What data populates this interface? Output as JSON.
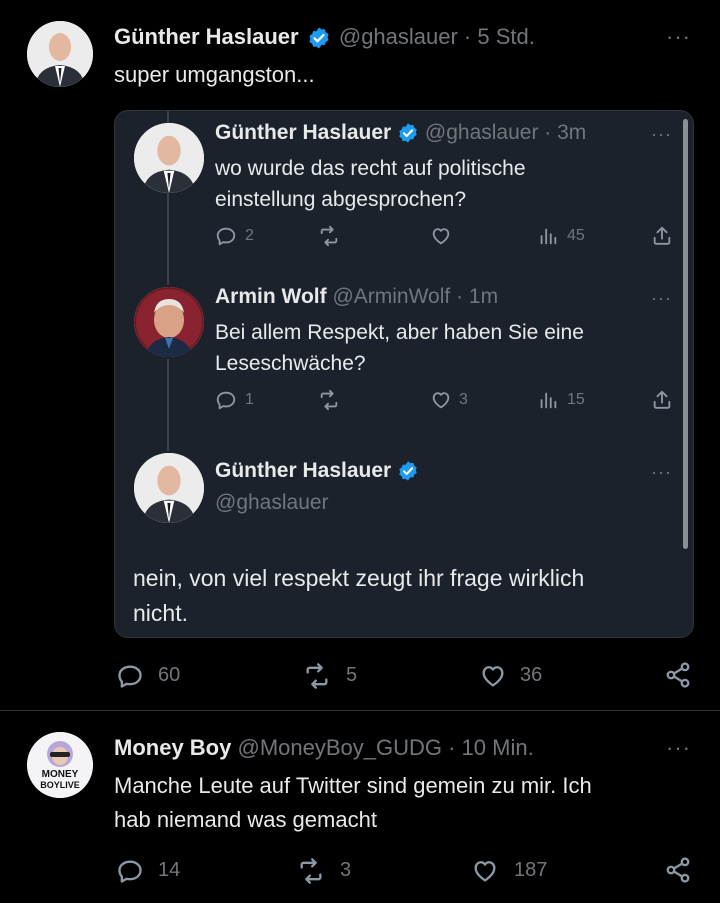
{
  "tweet1": {
    "author_name": "Günther Haslauer",
    "author_handle_time": "@ghaslauer · 5 Std.",
    "text": "super umgangston...",
    "quote": {
      "reply1": {
        "author_name": "Günther Haslauer",
        "author_handle_time": "@ghaslauer · 3m",
        "text_line1": "wo wurde das recht auf politische",
        "text_line2": "einstellung abgesprochen?",
        "replies": "2",
        "views": "45"
      },
      "reply2": {
        "author_name": "Armin Wolf",
        "author_handle_time": "@ArminWolf · 1m",
        "text_line1": "Bei allem Respekt, aber haben Sie eine",
        "text_line2": "Leseschwäche?",
        "replies": "1",
        "likes": "3",
        "views": "15"
      },
      "reply3": {
        "author_name": "Günther Haslauer",
        "author_handle": "@ghaslauer",
        "text_line1": "nein, von viel respekt zeugt ihr frage wirklich",
        "text_line2": "nicht."
      }
    },
    "replies": "60",
    "retweets": "5",
    "likes": "36"
  },
  "tweet2": {
    "author_name": "Money Boy",
    "author_handle_time": "@MoneyBoy_GUDG · 10 Min.",
    "text_line1": "Manche Leute auf Twitter sind gemein zu mir. Ich",
    "text_line2": "hab niemand was gemacht",
    "avatar_text_line1": "MONEY",
    "avatar_text_line2": "BOYLIVE",
    "replies": "14",
    "retweets": "3",
    "likes": "187"
  },
  "more_label": "···",
  "colors": {
    "background": "#000000",
    "card": "#1c222b",
    "verified": "#1d9bf0",
    "muted": "#71767b"
  }
}
